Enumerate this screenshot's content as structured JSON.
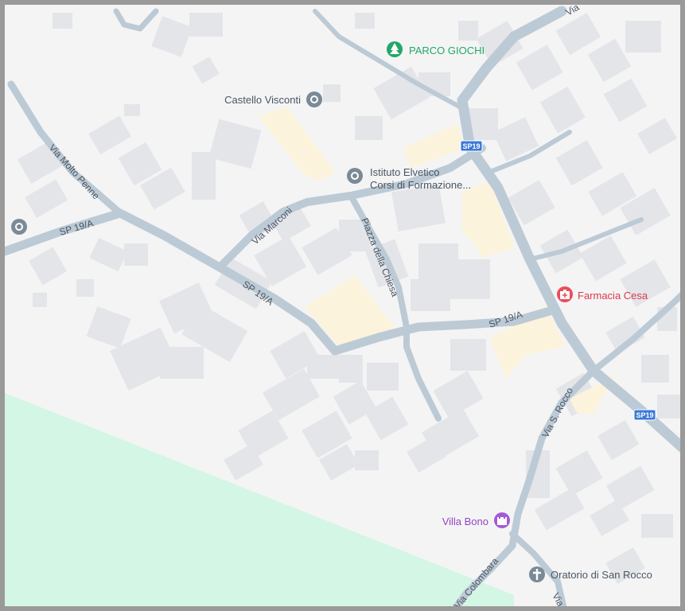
{
  "roads": {
    "via_molto_penne": "Via Molto Penne",
    "sp19a": "SP 19/A",
    "via_marconi": "Via Marconi",
    "piazza_della_chiesa": "Piazza della Chiesa",
    "via_s_rocco": "Via S. Rocco",
    "via_colombara": "Via Colombara",
    "via_truncated": "Via"
  },
  "shields": {
    "sp19": "SP19"
  },
  "pois": {
    "parco_giochi": "PARCO GIOCHI",
    "castello_visconti": "Castello Visconti",
    "istituto_line1": "Istituto Elvetico",
    "istituto_line2": "Corsi di Formazione...",
    "farmacia_cesa": "Farmacia Cesa",
    "villa_bono": "Villa Bono",
    "oratorio_san_rocco": "Oratorio di San Rocco"
  },
  "icons": {
    "parco_giochi": "tree-icon",
    "castello_visconti": "landmark-pin-icon",
    "istituto_elvetico": "landmark-pin-icon",
    "farmacia_cesa": "pharmacy-icon",
    "villa_bono": "castle-icon",
    "oratorio_san_rocco": "cross-icon"
  },
  "colors": {
    "park": "#d4f6e4",
    "road": "#bccad5",
    "building": "#e3e5e8",
    "highlight": "#fbf3dc",
    "poi_green": "#23a867",
    "poi_gray": "#7a8a97",
    "poi_red": "#ea4c5a",
    "poi_purple": "#a45bd6",
    "shield_blue": "#3b78d8"
  }
}
